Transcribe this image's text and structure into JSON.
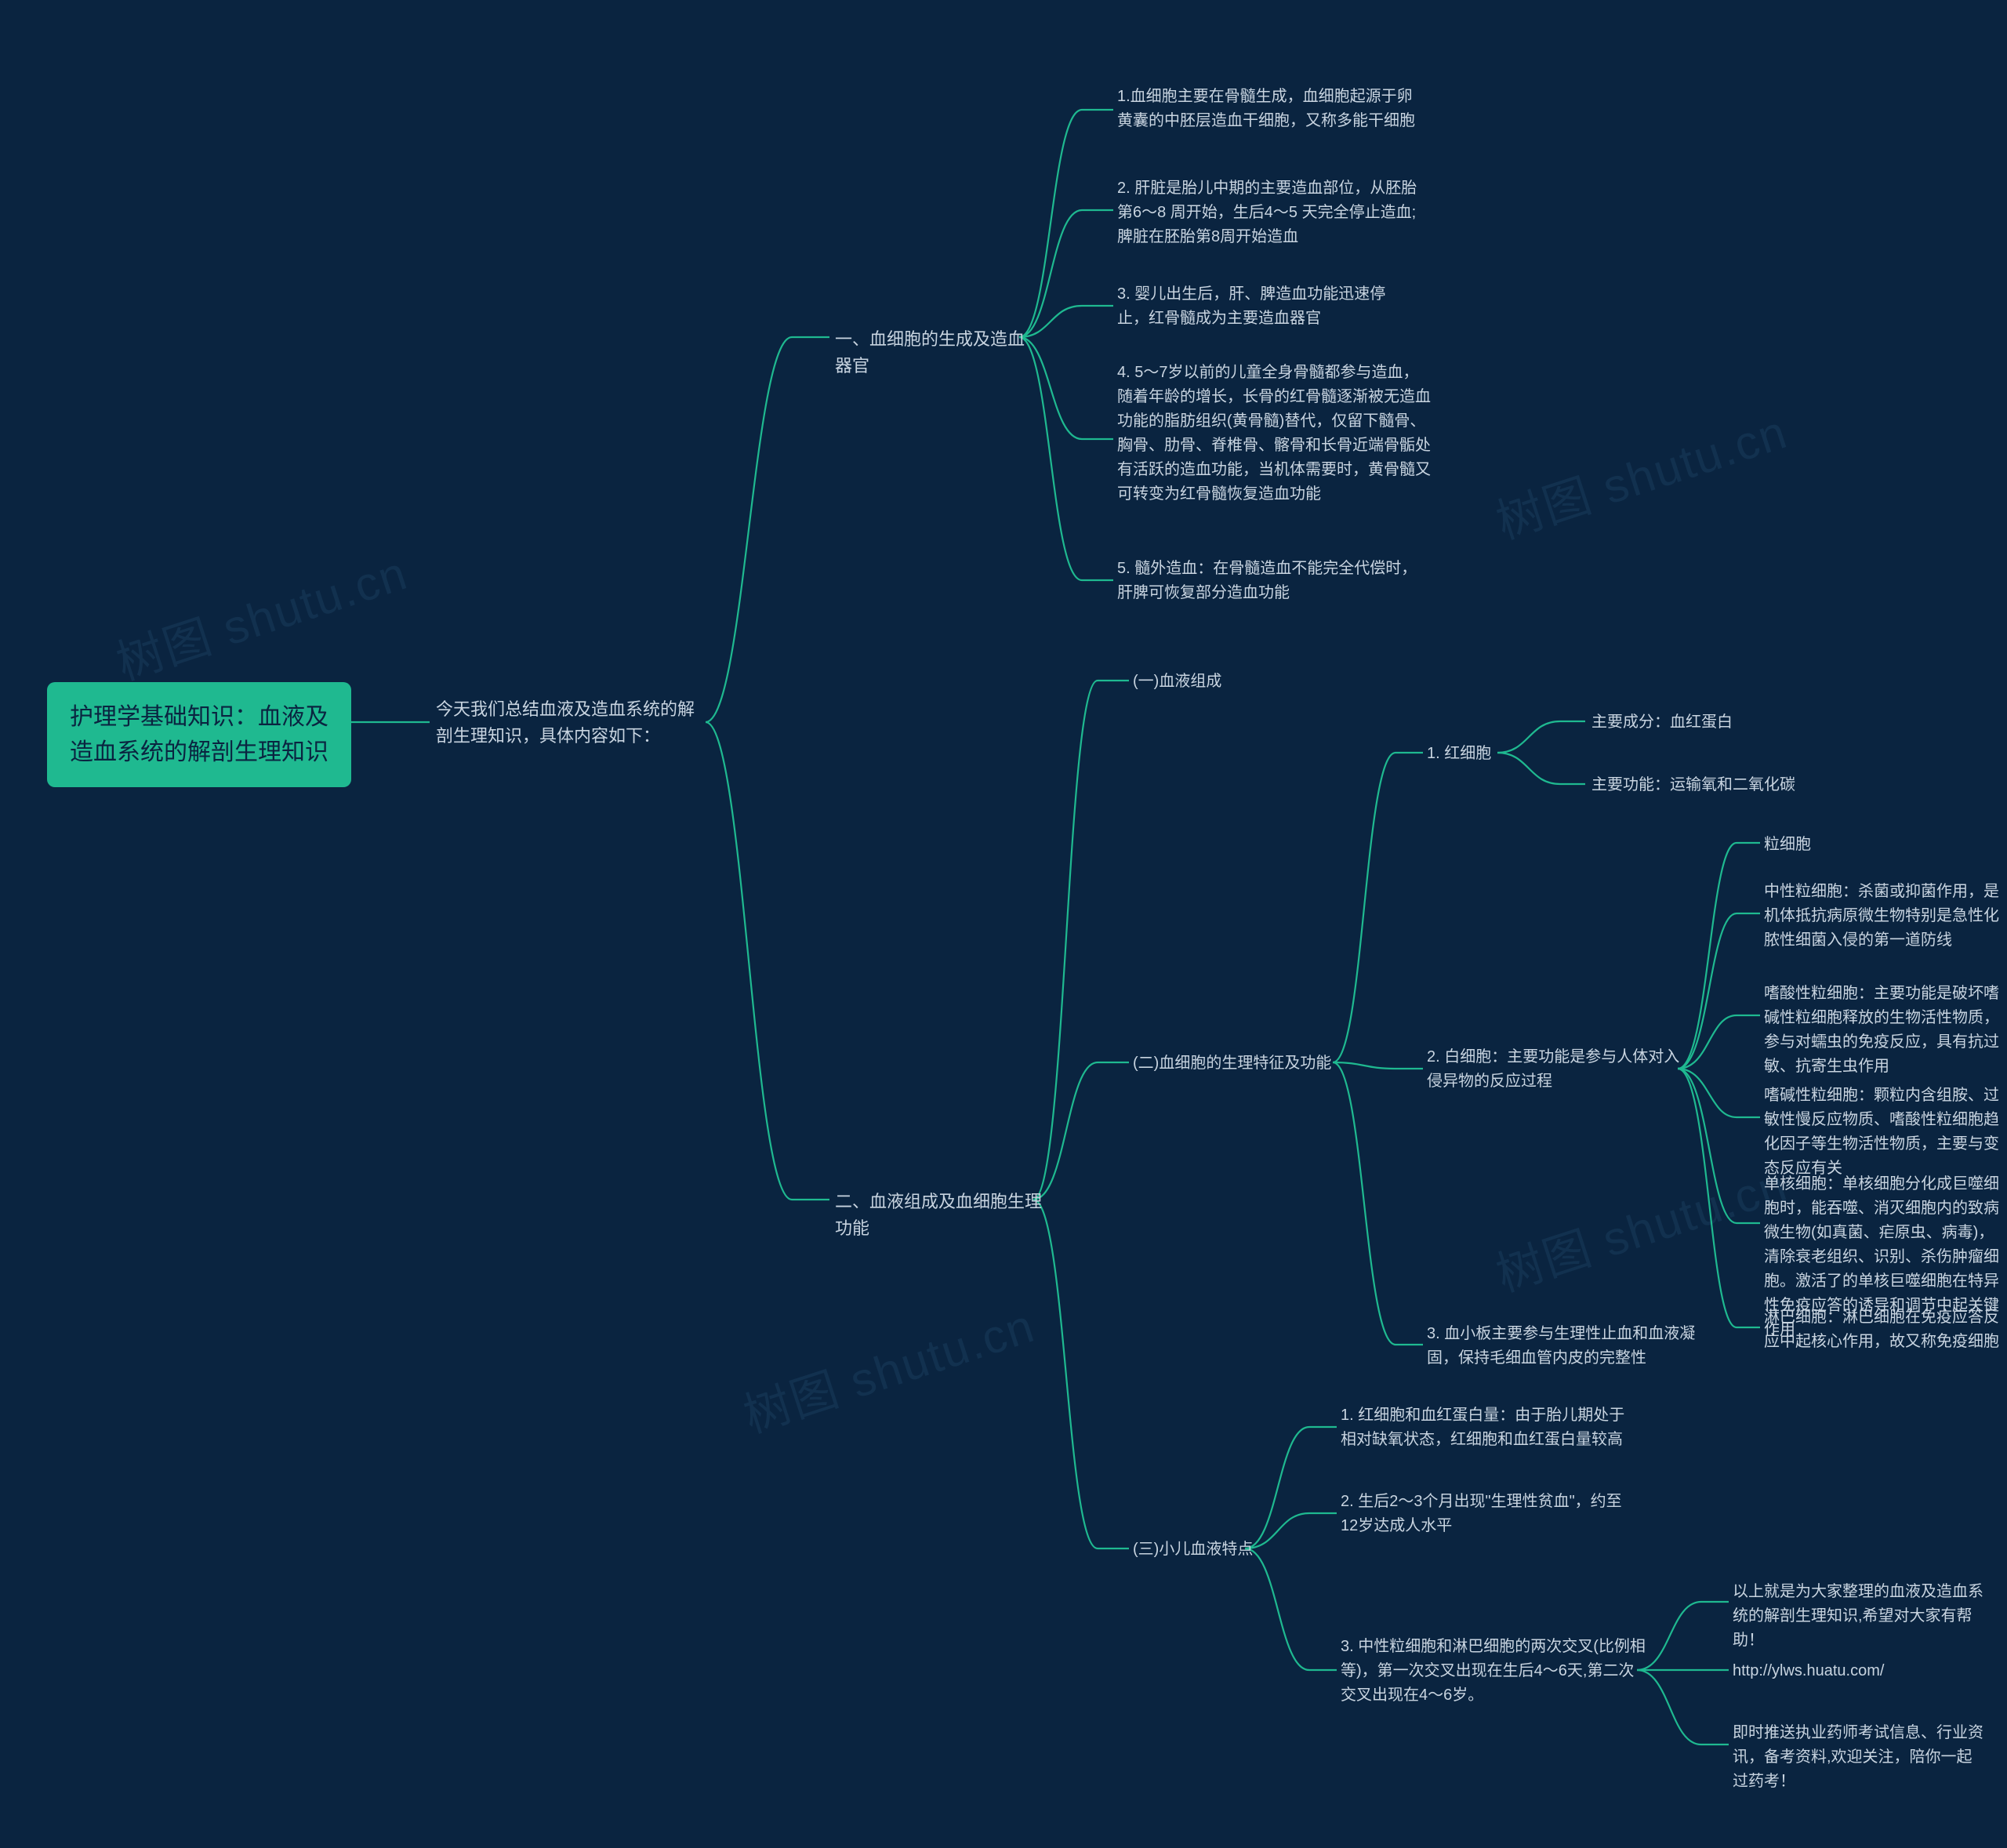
{
  "root": "护理学基础知识：血液及造血系统的解剖生理知识",
  "intro": "今天我们总结血液及造血系统的解剖生理知识，具体内容如下：",
  "s1": {
    "title": "一、血细胞的生成及造血器官",
    "p1": "1.血细胞主要在骨髓生成，血细胞起源于卵黄囊的中胚层造血干细胞，又称多能干细胞",
    "p2": "2. 肝脏是胎儿中期的主要造血部位，从胚胎第6～8 周开始，生后4～5 天完全停止造血;脾脏在胚胎第8周开始造血",
    "p3": "3. 婴儿出生后，肝、脾造血功能迅速停止，红骨髓成为主要造血器官",
    "p4": "4. 5～7岁以前的儿童全身骨髓都参与造血，随着年龄的增长，长骨的红骨髓逐渐被无造血功能的脂肪组织(黄骨髓)替代，仅留下髓骨、胸骨、肋骨、脊椎骨、髂骨和长骨近端骨骺处有活跃的造血功能，当机体需要时，黄骨髓又可转变为红骨髓恢复造血功能",
    "p5": "5. 髓外造血：在骨髓造血不能完全代偿时，肝脾可恢复部分造血功能"
  },
  "s2": {
    "title": "二、血液组成及血细胞生理功能",
    "a": "(一)血液组成",
    "b": {
      "title": "(二)血细胞的生理特征及功能",
      "rbc": {
        "title": "1. 红细胞",
        "c1": "主要成分：血红蛋白",
        "c2": "主要功能：运输氧和二氧化碳"
      },
      "wbc": {
        "title": "2. 白细胞：主要功能是参与人体对入侵异物的反应过程",
        "g1": "粒细胞",
        "g2": "中性粒细胞：杀菌或抑菌作用，是机体抵抗病原微生物特别是急性化脓性细菌入侵的第一道防线",
        "g3": "嗜酸性粒细胞：主要功能是破坏嗜碱性粒细胞释放的生物活性物质，参与对蠕虫的免疫反应，具有抗过敏、抗寄生虫作用",
        "g4": "嗜碱性粒细胞：颗粒内含组胺、过敏性慢反应物质、嗜酸性粒细胞趋化因子等生物活性物质，主要与变态反应有关",
        "g5": "单核细胞：单核细胞分化成巨噬细胞时，能吞噬、消灭细胞内的致病微生物(如真菌、疟原虫、病毒)，清除衰老组织、识别、杀伤肿瘤细胞。激活了的单核巨噬细胞在特异性免疫应答的诱导和调节中起关键作用",
        "g6": "淋巴细胞：淋巴细胞在免疫应答反应中起核心作用，故又称免疫细胞"
      },
      "plt": "3. 血小板主要参与生理性止血和血液凝固，保持毛细血管内皮的完整性"
    },
    "c": {
      "title": "(三)小儿血液特点",
      "p1": "1. 红细胞和血红蛋白量：由于胎儿期处于相对缺氧状态，红细胞和血红蛋白量较高",
      "p2": "2. 生后2～3个月出现\"生理性贫血\"，约至12岁达成人水平",
      "p3": "3. 中性粒细胞和淋巴细胞的两次交叉(比例相等)，第一次交叉出现在生后4～6天,第二次交叉出现在4～6岁。",
      "f1": "以上就是为大家整理的血液及造血系统的解剖生理知识,希望对大家有帮助！",
      "f2": "http://ylws.huatu.com/",
      "f3": "即时推送执业药师考试信息、行业资讯，备考资料,欢迎关注，陪你一起过药考！"
    }
  },
  "watermark": "树图 shutu.cn"
}
